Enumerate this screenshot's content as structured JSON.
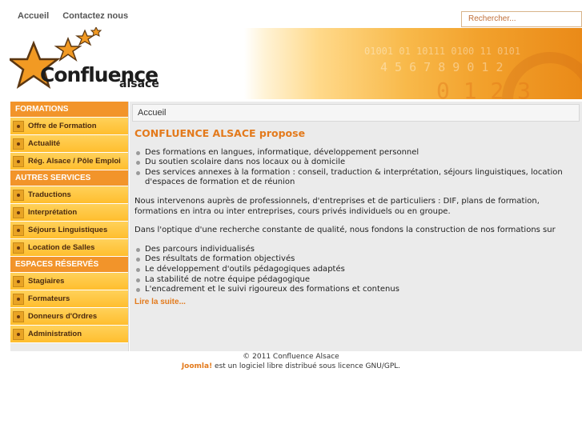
{
  "topnav": {
    "home": "Accueil",
    "contact": "Contactez nous"
  },
  "search": {
    "placeholder": "Rechercher..."
  },
  "logo": {
    "title": "Confluence",
    "subtitle": "alsace"
  },
  "sidebar": {
    "sections": [
      {
        "title": "FORMATIONS",
        "items": [
          "Offre de Formation",
          "Actualité",
          "Rég. Alsace / Pôle Emploi"
        ]
      },
      {
        "title": "AUTRES SERVICES",
        "items": [
          "Traductions",
          "Interprétation",
          "Séjours Linguistiques",
          "Location de Salles"
        ]
      },
      {
        "title": "ESPACES RÉSERVÉS",
        "items": [
          "Stagiaires",
          "Formateurs",
          "Donneurs d'Ordres",
          "Administration"
        ]
      }
    ]
  },
  "breadcrumb": "Accueil",
  "article": {
    "title": "CONFLUENCE ALSACE propose",
    "list1": [
      "Des formations en langues, informatique, développement personnel",
      "Du soutien scolaire dans nos locaux ou à domicile",
      "Des services annexes à la formation : conseil, traduction & interprétation, séjours linguistiques, location d'espaces de formation et de réunion"
    ],
    "para1": "Nous intervenons auprès de professionnels, d'entreprises et de particuliers : DIF, plans de formation, formations en intra ou inter entreprises, cours privés individuels ou en groupe.",
    "para2": "Dans l'optique d'une recherche constante de qualité, nous fondons la construction de nos formations sur",
    "list2": [
      "Des parcours individualisés",
      "Des résultats de formation objectivés",
      "Le développement d'outils pédagogiques adaptés",
      "La stabilité de notre équipe pédagogique",
      "L'encadrement et le suivi rigoureux des formations et contenus"
    ],
    "readmore": "Lire la suite..."
  },
  "footer": {
    "copyright": "© 2011 Confluence Alsace",
    "joomla": "Joomla!",
    "license": " est un logiciel libre distribué sous licence GNU/GPL."
  },
  "colors": {
    "accent": "#e37a1c",
    "menu_yellow": "#ffc83e",
    "section_orange": "#f2942a"
  }
}
